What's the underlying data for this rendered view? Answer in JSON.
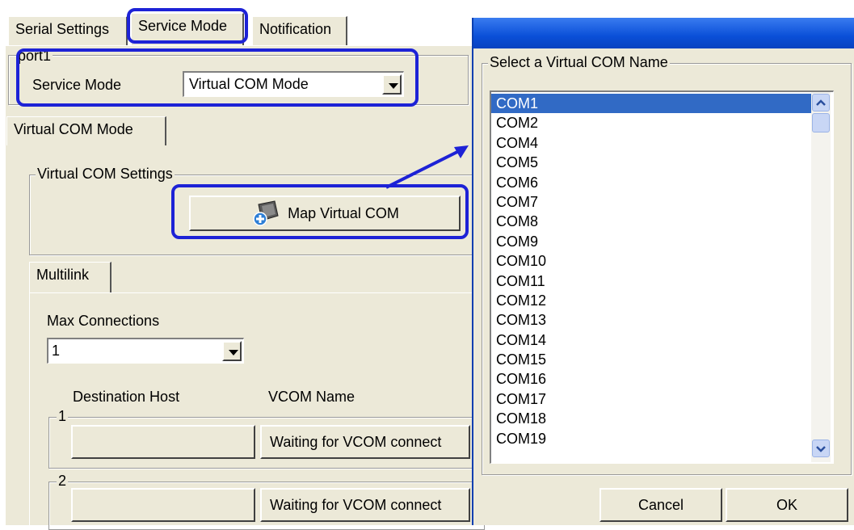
{
  "tabs": [
    "Serial Settings",
    "Service Mode",
    "Notification"
  ],
  "port_group": {
    "legend": "port1",
    "service_mode_label": "Service Mode",
    "service_mode_value": "Virtual COM Mode"
  },
  "vcom_tab": "Virtual COM Mode",
  "vcom_settings": {
    "legend": "Virtual COM Settings",
    "map_button": "Map Virtual COM"
  },
  "multilink": {
    "tab": "Multilink",
    "max_connections_label": "Max Connections",
    "max_connections_value": "1",
    "col_destination": "Destination Host",
    "col_vcom": "VCOM Name",
    "rows": [
      {
        "legend": "1",
        "destination": "",
        "vcom": "Waiting for VCOM connect"
      },
      {
        "legend": "2",
        "destination": "",
        "vcom": "Waiting for VCOM connect"
      }
    ]
  },
  "dialog": {
    "legend": "Select a Virtual COM Name",
    "items": [
      "COM1",
      "COM2",
      "COM4",
      "COM5",
      "COM6",
      "COM7",
      "COM8",
      "COM9",
      "COM10",
      "COM11",
      "COM12",
      "COM13",
      "COM14",
      "COM15",
      "COM16",
      "COM17",
      "COM18",
      "COM19"
    ],
    "selected": "COM1",
    "cancel": "Cancel",
    "ok": "OK"
  },
  "colors": {
    "highlight": "#1d22d6",
    "selection": "#316ac5",
    "titlebar": "#0a4fd8"
  }
}
